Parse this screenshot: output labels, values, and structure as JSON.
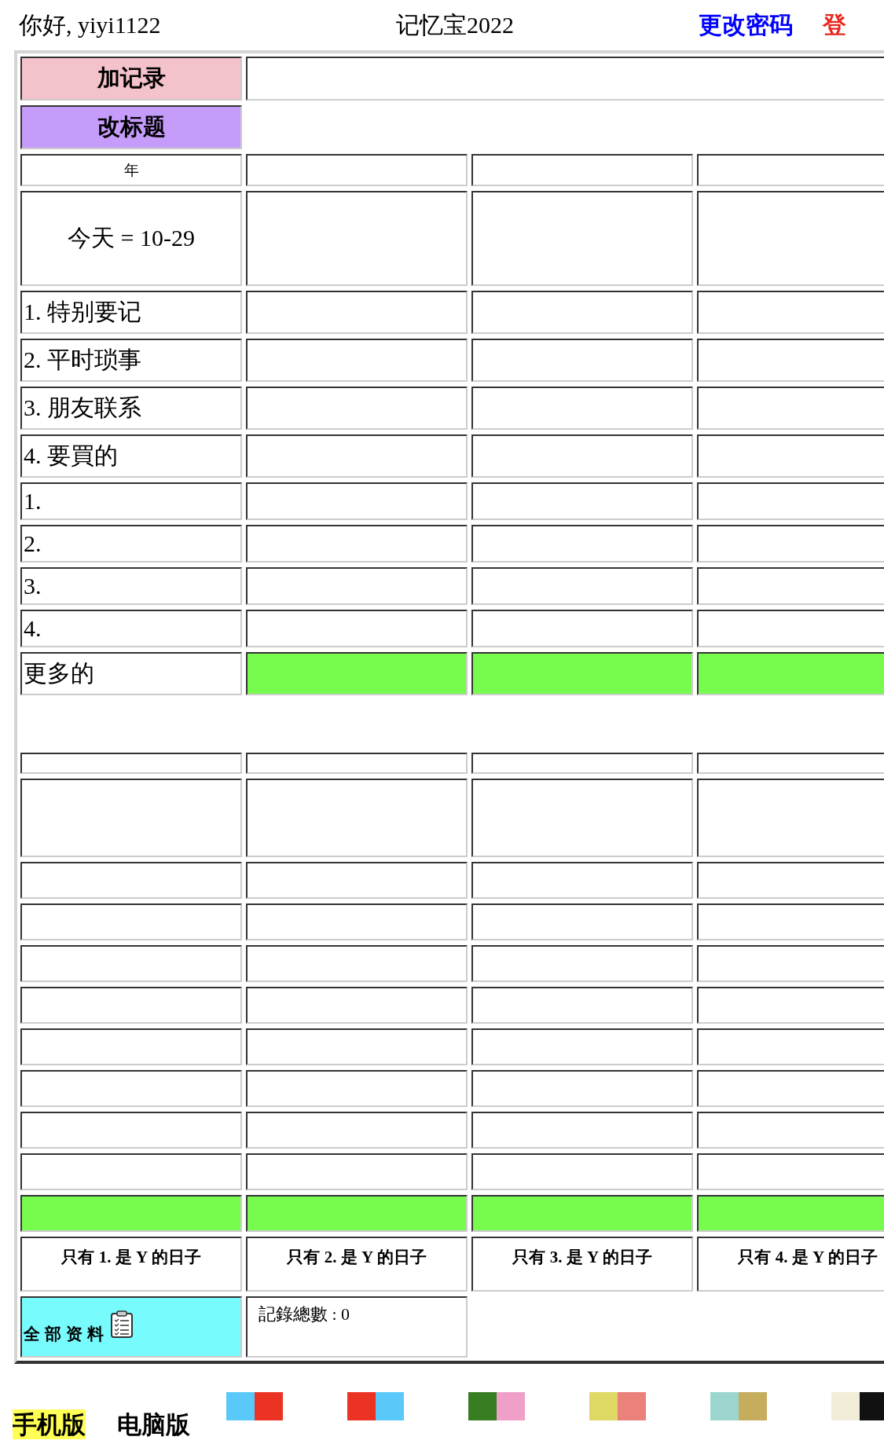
{
  "header": {
    "greeting": "你好, yiyi1122",
    "title": "记忆宝2022",
    "links": [
      {
        "kind": "password",
        "label": "更改密码"
      },
      {
        "kind": "logout",
        "label": "登"
      }
    ]
  },
  "table": {
    "actions": [
      {
        "kind": "add",
        "label": "加记录"
      },
      {
        "kind": "rename",
        "label": "改标题"
      }
    ],
    "year_label": "年",
    "today": "今天 = 10-29",
    "categories": [
      "1. 特别要记",
      "2. 平时琐事",
      "3. 朋友联系",
      "4. 要買的"
    ],
    "numbered": [
      "1.",
      "2.",
      "3.",
      "4."
    ],
    "more": "更多的",
    "filters": [
      "只有 1. 是 Y 的日子",
      "只有 2. 是 Y 的日子",
      "只有 3. 是 Y 的日子",
      "只有 4. 是 Y 的日子"
    ],
    "all_data": "全部资料",
    "record_count": "記錄總數 : 0"
  },
  "footer": {
    "versions": [
      {
        "label": "手机版",
        "selected": true
      },
      {
        "label": "电脑版",
        "selected": false
      }
    ],
    "swatches": [
      {
        "halves": [
          {
            "color": "#5bc8fa"
          },
          {
            "color": "#ea3323"
          }
        ]
      },
      {
        "halves": [
          {
            "color": "#ea3323"
          },
          {
            "color": "#5bc8fa"
          }
        ]
      },
      {
        "halves": [
          {
            "color": "#377d22"
          },
          {
            "color": "#f0a0c8"
          }
        ]
      },
      {
        "halves": [
          {
            "color": "#dfd865"
          },
          {
            "color": "#eb817b"
          }
        ]
      },
      {
        "halves": [
          {
            "color": "#9cd5cd"
          },
          {
            "color": "#c6ad5e"
          }
        ]
      },
      {
        "halves": [
          {
            "color": "#f2edd8"
          },
          {
            "color": "#111111"
          }
        ]
      }
    ]
  }
}
